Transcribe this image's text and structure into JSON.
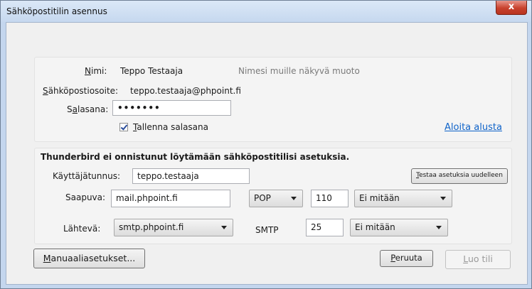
{
  "window": {
    "title": "Sähköpostitilin asennus",
    "close_glyph": "x"
  },
  "identity": {
    "name_label": "Nimi:",
    "name_value": "Teppo Testaaja",
    "name_hint": "Nimesi muille näkyvä muoto",
    "email_label": "Sähköpostiosoite:",
    "email_value": "teppo.testaaja@phpoint.fi",
    "password_label": "Salasana:",
    "password_value": "•••••••",
    "remember_label": "Tallenna salasana",
    "remember_checked": true,
    "restart_link": "Aloita alusta"
  },
  "settings": {
    "heading": "Thunderbird ei onnistunut löytämään sähköpostitilisi asetuksia.",
    "username_label": "Käyttäjätunnus:",
    "username_value": "teppo.testaaja",
    "retest_button": "Testaa asetuksia uudelleen",
    "incoming_label": "Saapuva:",
    "incoming_server": "mail.phpoint.fi",
    "incoming_protocol": "POP",
    "incoming_port": "110",
    "incoming_security": "Ei mitään",
    "outgoing_label": "Lähtevä:",
    "outgoing_server": "smtp.phpoint.fi",
    "outgoing_protocol": "SMTP",
    "outgoing_port": "25",
    "outgoing_security": "Ei mitään"
  },
  "footer": {
    "manual_button": "Manuaaliasetukset...",
    "cancel_button": "Peruuta",
    "create_button": "Luo tili"
  }
}
